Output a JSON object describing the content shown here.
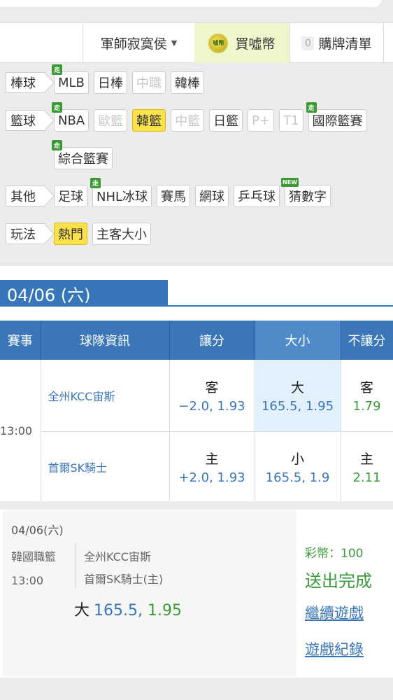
{
  "header": {
    "user_menu": "軍師寂寞侯",
    "buy_label": "買噓幣",
    "coin_text": "噓幣",
    "list_count": "0",
    "list_label": "購牌清單"
  },
  "filters": {
    "baseball": {
      "label": "棒球",
      "tags": [
        "MLB",
        "日棒",
        "中職",
        "韓棒"
      ]
    },
    "basketball": {
      "label": "籃球",
      "tags": [
        "NBA",
        "歐籃",
        "韓籃",
        "中籃",
        "日籃",
        "P+",
        "T1",
        "國際籃賽",
        "綜合籃賽"
      ]
    },
    "other": {
      "label": "其他",
      "tags": [
        "足球",
        "NHL冰球",
        "賽馬",
        "網球",
        "乒乓球",
        "猜數字"
      ]
    },
    "play": {
      "label": "玩法",
      "tags": [
        "熱門",
        "主客大小"
      ]
    },
    "live_badge": "走",
    "new_badge": "NEW"
  },
  "date_tab": "04/06 (六)",
  "table": {
    "headers": [
      "賽事",
      "球隊資訊",
      "讓分",
      "大小",
      "不讓分"
    ],
    "time": "13:00",
    "rows": [
      {
        "team": "全州KCC宙斯",
        "spread_side": "客",
        "spread_line": "−2.0,",
        "spread_odds": "1.93",
        "ou_side": "大",
        "ou_line": "165.5,",
        "ou_odds": "1.95",
        "ml_side": "客",
        "ml_odds": "1.79"
      },
      {
        "team": "首爾SK騎士",
        "spread_side": "主",
        "spread_line": "+2.0,",
        "spread_odds": "1.93",
        "ou_side": "小",
        "ou_line": "165.5,",
        "ou_odds": "1.9",
        "ml_side": "主",
        "ml_odds": "2.11"
      }
    ]
  },
  "slip": {
    "date": "04/06(六)",
    "league": "韓國職籃",
    "time": "13:00",
    "team_away": "全州KCC宙斯",
    "team_home": "首爾SK騎士(主)",
    "bet_side": "大",
    "bet_line": "165.5,",
    "bet_odds": "1.95",
    "coins": "彩幣：100",
    "status": "送出完成",
    "continue": "繼續遊戲",
    "history": "遊戲紀錄"
  },
  "colors": {
    "brand_blue": "#3676b9",
    "selected_yellow": "#fce24a",
    "odds_green": "#3a9a3a",
    "live_green": "#3c9a34"
  }
}
